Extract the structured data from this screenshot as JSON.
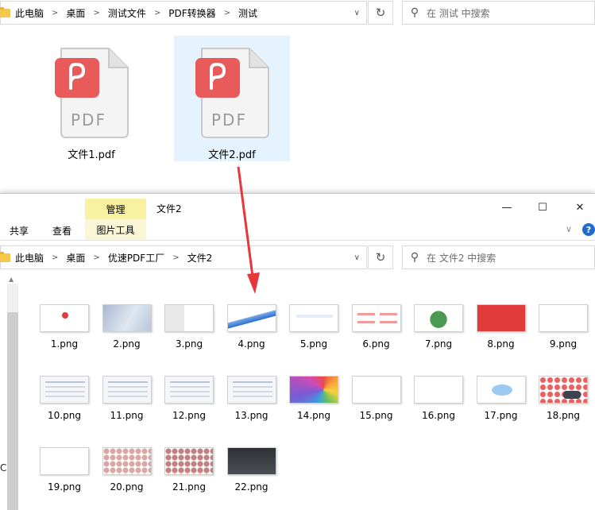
{
  "top_window": {
    "breadcrumb": [
      "此电脑",
      "桌面",
      "测试文件",
      "PDF转换器",
      "测试"
    ],
    "search_placeholder": "在 测试 中搜索",
    "files": [
      {
        "name": "文件1.pdf",
        "badge": "PDF",
        "selected": false
      },
      {
        "name": "文件2.pdf",
        "badge": "PDF",
        "selected": true
      }
    ]
  },
  "bottom_window": {
    "title": "文件2",
    "contextual_tab": "管理",
    "contextual_subtab": "图片工具",
    "ribbon_tabs": [
      "共享",
      "查看"
    ],
    "breadcrumb": [
      "此电脑",
      "桌面",
      "优速PDF工厂",
      "文件2"
    ],
    "search_placeholder": "在 文件2 中搜索",
    "sidebar_fragment": "C",
    "thumbnails": [
      {
        "name": "1.png"
      },
      {
        "name": "2.png"
      },
      {
        "name": "3.png"
      },
      {
        "name": "4.png"
      },
      {
        "name": "5.png"
      },
      {
        "name": "6.png"
      },
      {
        "name": "7.png"
      },
      {
        "name": "8.png"
      },
      {
        "name": "9.png"
      },
      {
        "name": "10.png"
      },
      {
        "name": "11.png"
      },
      {
        "name": "12.png"
      },
      {
        "name": "13.png"
      },
      {
        "name": "14.png"
      },
      {
        "name": "15.png"
      },
      {
        "name": "16.png"
      },
      {
        "name": "17.png"
      },
      {
        "name": "18.png"
      },
      {
        "name": "19.png"
      },
      {
        "name": "20.png"
      },
      {
        "name": "21.png"
      },
      {
        "name": "22.png"
      }
    ]
  },
  "colors": {
    "pdf_red": "#e95a5a",
    "selection": "#e5f3ff",
    "contextual_tab": "#f7f1a0",
    "arrow_red": "#e8373a"
  },
  "icons": [
    "folder-icon",
    "refresh-icon",
    "search-icon",
    "chevron-down-icon",
    "minimize-icon",
    "maximize-icon",
    "close-icon",
    "help-icon",
    "pdf-file-icon"
  ]
}
